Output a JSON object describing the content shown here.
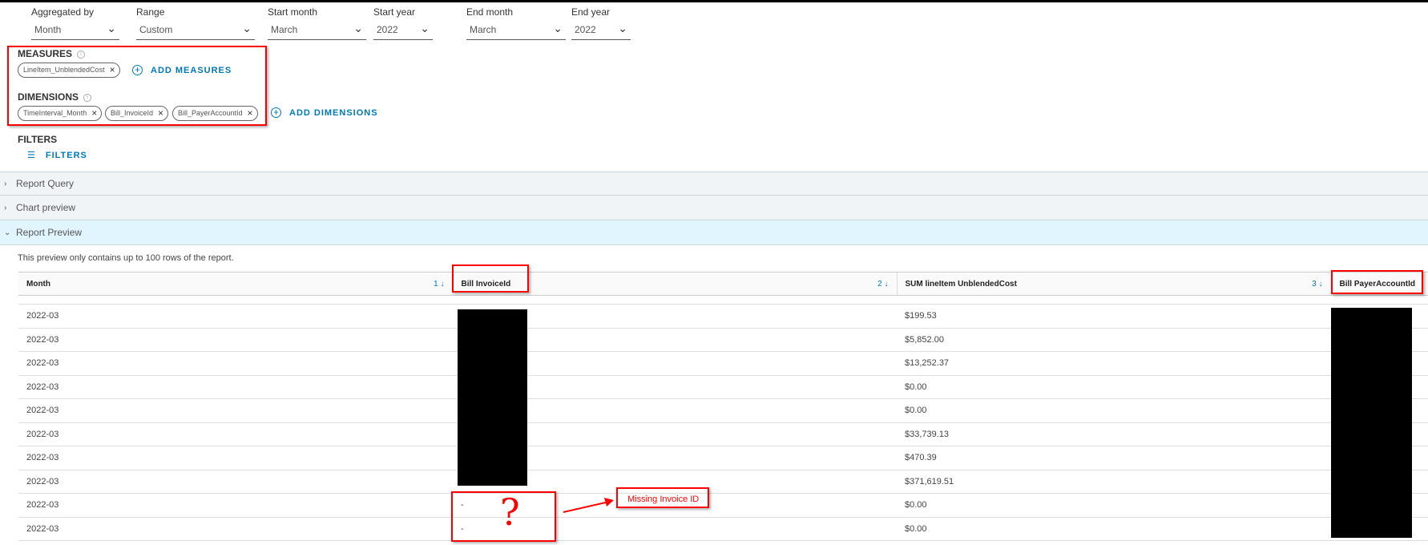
{
  "filters_bar": [
    {
      "label": "Aggregated by",
      "value": "Month"
    },
    {
      "label": "Range",
      "value": "Custom"
    },
    {
      "label": "Start month",
      "value": "March"
    },
    {
      "label": "Start year",
      "value": "2022"
    },
    {
      "label": "End month",
      "value": "March"
    },
    {
      "label": "End year",
      "value": "2022"
    }
  ],
  "measures": {
    "title": "MEASURES",
    "chips": [
      "LineItem_UnblendedCost"
    ],
    "add_label": "ADD MEASURES"
  },
  "dimensions": {
    "title": "DIMENSIONS",
    "chips": [
      "TimeInterval_Month",
      "Bill_InvoiceId",
      "Bill_PayerAccountId"
    ],
    "add_label": "ADD DIMENSIONS"
  },
  "filters": {
    "title": "FILTERS",
    "button_label": "FILTERS"
  },
  "sections": [
    {
      "label": "Report Query",
      "expanded": false
    },
    {
      "label": "Chart preview",
      "expanded": false
    },
    {
      "label": "Report Preview",
      "expanded": true
    }
  ],
  "preview_note": "This preview only contains up to 100 rows of the report.",
  "table": {
    "columns": [
      {
        "label": "Month",
        "sort": "1 ↓"
      },
      {
        "label": "Bill InvoiceId",
        "sort": "2 ↓"
      },
      {
        "label": "SUM lineItem UnblendedCost",
        "sort": "3 ↓"
      },
      {
        "label": "Bill PayerAccountId",
        "sort": ""
      }
    ],
    "rows": [
      {
        "month": "2022-03",
        "invoice": "",
        "cost": "$199.53"
      },
      {
        "month": "2022-03",
        "invoice": "",
        "cost": "$5,852.00"
      },
      {
        "month": "2022-03",
        "invoice": "",
        "cost": "$13,252.37"
      },
      {
        "month": "2022-03",
        "invoice": "",
        "cost": "$0.00"
      },
      {
        "month": "2022-03",
        "invoice": "",
        "cost": "$0.00"
      },
      {
        "month": "2022-03",
        "invoice": "",
        "cost": "$33,739.13"
      },
      {
        "month": "2022-03",
        "invoice": "",
        "cost": "$470.39"
      },
      {
        "month": "2022-03",
        "invoice": "",
        "cost": "$371,619.51"
      },
      {
        "month": "2022-03",
        "invoice": "-",
        "cost": "$0.00"
      },
      {
        "month": "2022-03",
        "invoice": "-",
        "cost": "$0.00"
      }
    ]
  },
  "annotation": {
    "label": "Missing Invoice ID",
    "mark": "?",
    "color": "#ff0000"
  }
}
